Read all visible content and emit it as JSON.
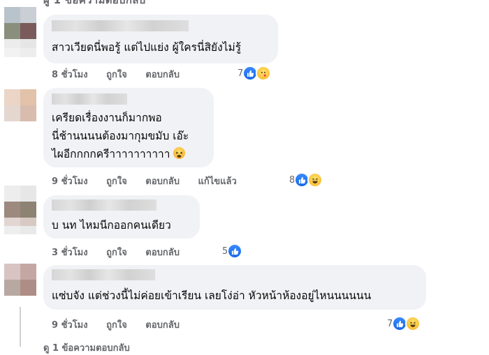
{
  "top_cutoff_text": "ผู้ 1 ข้อความตอบกลับ",
  "bottom_cutoff_text": "ดู 1 ข้อความตอบกลับ",
  "action_labels": {
    "like": "ถูกใจ",
    "reply": "ตอบกลับ"
  },
  "comments": [
    {
      "lines": [
        "สาวเวียดนี่พอรู้ แต่ไปแย่ง ผู้ใครนี่สิยังไม่รู้"
      ],
      "time": "8 ชั่วโมง",
      "edited": "",
      "reaction_count": "7",
      "reactions": [
        "like-icon",
        "care-icon"
      ]
    },
    {
      "lines": [
        "เครียดเรื่องงานก็มากพอ",
        "นี่ช้านนนนต้องมากุมขมับ เอ๊ะ",
        "ไผอีกกกกครีาาาาาาาาาา"
      ],
      "inline_emoji": "tired-face-emoji",
      "time": "9 ชั่วโมง",
      "edited": "แก้ไขแล้ว",
      "reaction_count": "8",
      "reactions": [
        "like-icon",
        "haha-icon"
      ]
    },
    {
      "lines": [
        "บ นท ไหมนีกออกคนเดียว"
      ],
      "time": "3 ชั่วโมง",
      "edited": "",
      "reaction_count": "5",
      "reactions": [
        "like-icon"
      ]
    },
    {
      "lines": [
        "แซ่บจัง แต่ช่วงนี้ไม่ค่อยเข้าเรียน เลยโง่อ่า หัวหน้าห้องอยู่ไหนนนนนน"
      ],
      "time": "9 ชั่วโมง",
      "edited": "",
      "reaction_count": "7",
      "reactions": [
        "like-icon",
        "haha-icon"
      ]
    }
  ],
  "colors": {
    "bubble": "#f0f2f5",
    "meta_text": "#65676b",
    "like_blue": "#1877f2",
    "emoji_yellow": "#f7b125"
  }
}
